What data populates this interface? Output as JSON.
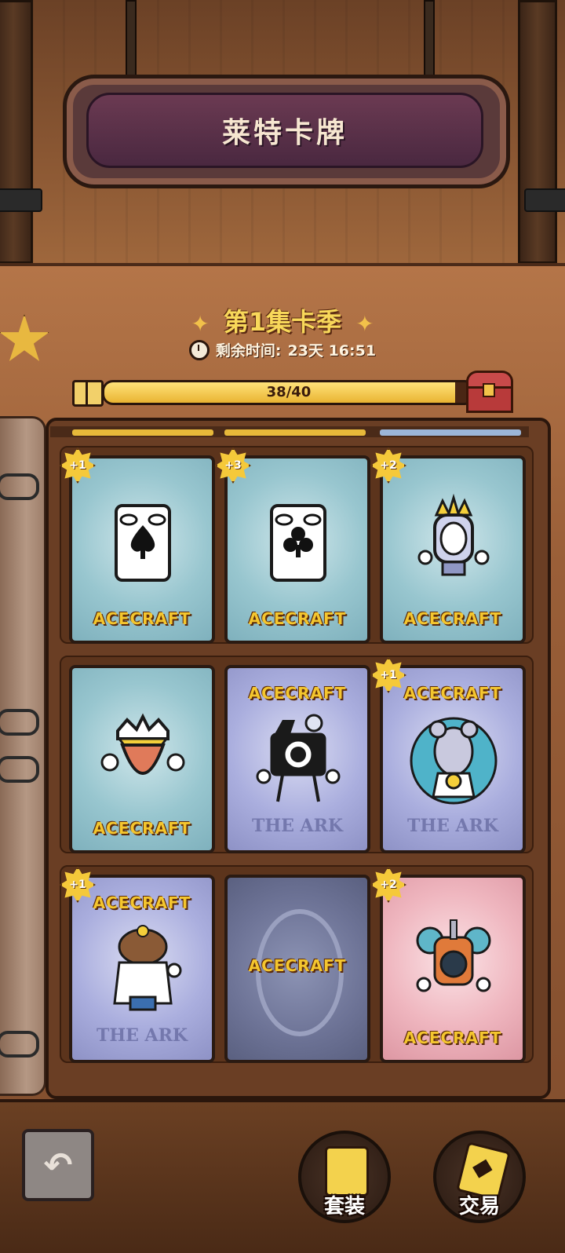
{
  "header": {
    "title": "莱特卡牌"
  },
  "season": {
    "title": "第1集卡季",
    "timer_label": "剩余时间:",
    "timer_value": "23天 16:51"
  },
  "progress": {
    "text": "38/40",
    "current": 38,
    "total": 40,
    "fraction": 0.95
  },
  "brand": "ACECRAFT",
  "ark_text": "THE ARK",
  "cards": [
    {
      "badge": "+1",
      "theme": "blue",
      "subject": "spade-card"
    },
    {
      "badge": "+3",
      "theme": "blue",
      "subject": "club-card"
    },
    {
      "badge": "+2",
      "theme": "blue",
      "subject": "crowned-robot"
    },
    {
      "badge": "",
      "theme": "blue",
      "subject": "king-head"
    },
    {
      "badge": "",
      "theme": "purple",
      "subject": "camera-character"
    },
    {
      "badge": "+1",
      "theme": "purple",
      "subject": "rat-scientist"
    },
    {
      "badge": "+1",
      "theme": "purple",
      "subject": "capybara-doctor"
    },
    {
      "badge": "",
      "theme": "back",
      "subject": "card-back"
    },
    {
      "badge": "+2",
      "theme": "pink",
      "subject": "cannon-robot"
    }
  ],
  "buttons": {
    "sets": "套装",
    "trade": "交易"
  },
  "colors": {
    "accent": "#f4c62e",
    "sign": "#5a3a4a",
    "card_blue": "#98c6cf",
    "card_purple": "#aaaede",
    "card_pink": "#efb6bf"
  }
}
